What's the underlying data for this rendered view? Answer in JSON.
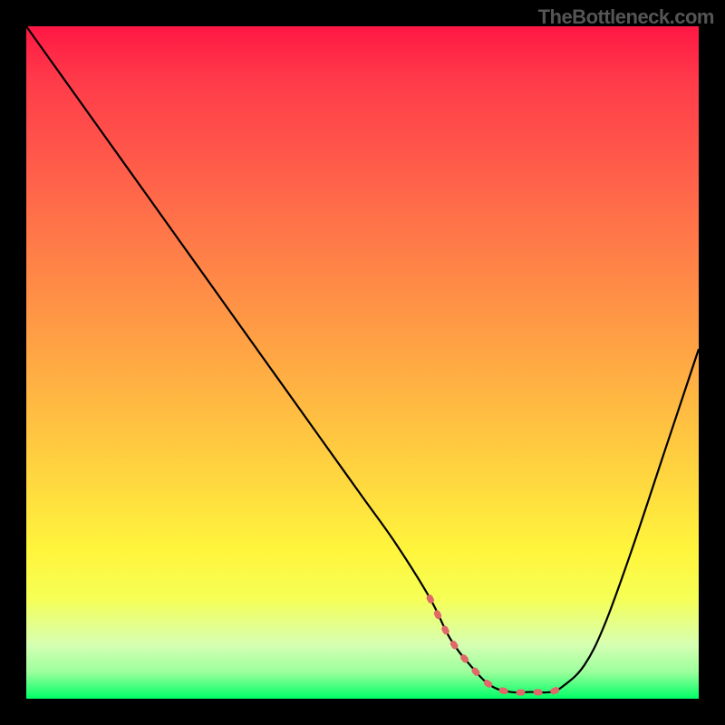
{
  "watermark": "TheBottleneck.com",
  "chart_data": {
    "type": "line",
    "title": "",
    "xlabel": "",
    "ylabel": "",
    "xlim": [
      0,
      100
    ],
    "ylim": [
      0,
      100
    ],
    "series": [
      {
        "name": "main-curve",
        "color": "#000000",
        "x": [
          0,
          5,
          10,
          15,
          20,
          25,
          30,
          35,
          40,
          45,
          50,
          55,
          60,
          63,
          66,
          69,
          72,
          75,
          78,
          80,
          83,
          86,
          90,
          95,
          100
        ],
        "values": [
          100,
          93,
          86,
          79,
          72,
          65,
          58,
          51,
          44,
          37,
          30,
          23,
          15,
          9,
          5,
          2,
          1,
          1,
          1,
          2,
          5,
          11,
          22,
          37,
          52
        ]
      },
      {
        "name": "highlight-segment",
        "color": "#e57373",
        "style": "dashed",
        "x": [
          60,
          63,
          66,
          69,
          72,
          75,
          78,
          80
        ],
        "values": [
          15,
          9,
          5,
          2,
          1,
          1,
          1,
          2
        ]
      }
    ],
    "gradient": {
      "top": "#ff1744",
      "mid": "#ffd93f",
      "bottom": "#00ff66"
    }
  }
}
